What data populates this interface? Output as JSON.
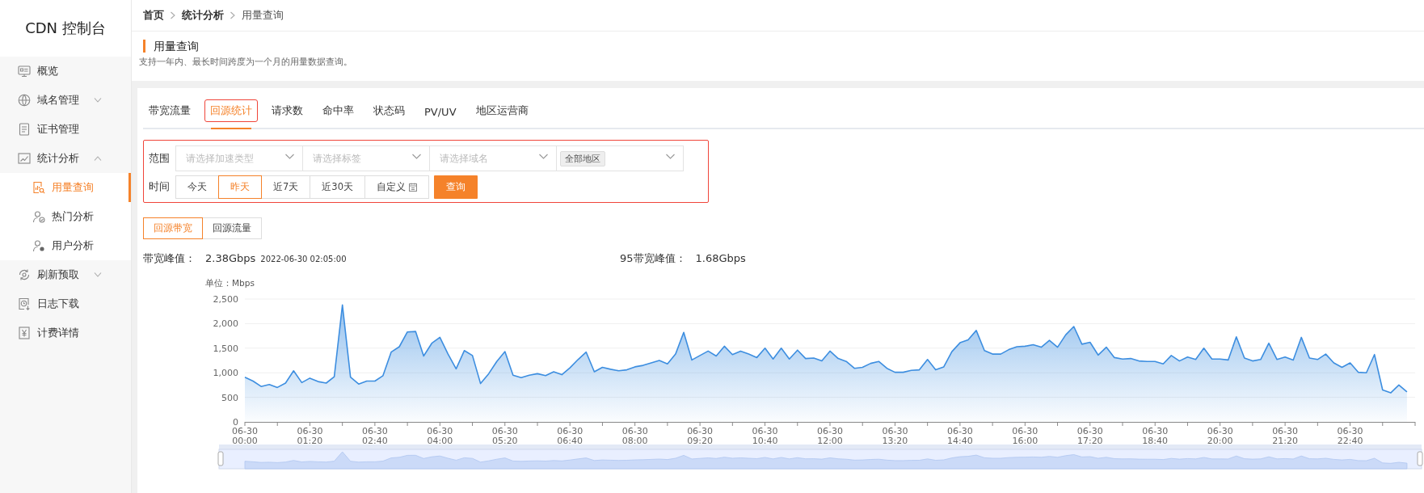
{
  "sidebar": {
    "title": "CDN 控制台",
    "items": [
      {
        "kind": "link",
        "label": "概览"
      },
      {
        "kind": "group",
        "label": "域名管理",
        "expanded": false
      },
      {
        "kind": "link",
        "label": "证书管理"
      },
      {
        "kind": "group",
        "label": "统计分析",
        "expanded": true,
        "children": [
          {
            "label": "用量查询",
            "selected": true
          },
          {
            "label": "热门分析",
            "selected": false
          },
          {
            "label": "用户分析",
            "selected": false
          }
        ]
      },
      {
        "kind": "group",
        "label": "刷新预取",
        "expanded": false
      },
      {
        "kind": "link",
        "label": "日志下载"
      },
      {
        "kind": "link",
        "label": "计费详情"
      }
    ]
  },
  "breadcrumb": [
    "首页",
    "统计分析",
    "用量查询"
  ],
  "page_header": {
    "title": "用量查询",
    "description": "支持一年内、最长时间跨度为一个月的用量数据查询。"
  },
  "tabs": [
    {
      "label": "带宽流量",
      "selected": false
    },
    {
      "label": "回源统计",
      "selected": true
    },
    {
      "label": "请求数",
      "selected": false
    },
    {
      "label": "命中率",
      "selected": false
    },
    {
      "label": "状态码",
      "selected": false
    },
    {
      "label": "PV/UV",
      "selected": false
    },
    {
      "label": "地区运营商",
      "selected": false
    }
  ],
  "filters": {
    "scope_label": "范围",
    "selects": [
      {
        "placeholder": "请选择加速类型"
      },
      {
        "placeholder": "请选择标签"
      },
      {
        "placeholder": "请选择域名"
      },
      {
        "tag": "全部地区"
      }
    ],
    "time_label": "时间",
    "time_options": [
      {
        "label": "今天",
        "selected": false
      },
      {
        "label": "昨天",
        "selected": true
      },
      {
        "label": "近7天",
        "selected": false
      },
      {
        "label": "近30天",
        "selected": false
      },
      {
        "label": "自定义",
        "selected": false,
        "calendar": true
      }
    ],
    "query_button": "查询"
  },
  "metric_toggle": [
    {
      "label": "回源带宽",
      "selected": true
    },
    {
      "label": "回源流量",
      "selected": false
    }
  ],
  "stats": {
    "peak_label": "带宽峰值：",
    "peak_value": "2.38Gbps",
    "peak_time": "2022-06-30 02:05:00",
    "p95_label": "95带宽峰值：",
    "p95_value": "1.68Gbps"
  },
  "chart_data": {
    "type": "area",
    "ylabel": "单位：Mbps",
    "grid": true,
    "ylim": [
      0,
      2500
    ],
    "yticks": [
      0,
      500,
      {
        "value": 1000,
        "label": "1,000"
      },
      {
        "value": 1500,
        "label": "1,500"
      },
      {
        "value": 2000,
        "label": "2,000"
      },
      {
        "value": 2500,
        "label": "2,500"
      }
    ],
    "categories": [
      "06-30 00:00",
      null,
      null,
      null,
      null,
      null,
      null,
      null,
      "06-30 01:20",
      null,
      null,
      null,
      null,
      null,
      null,
      null,
      "06-30 02:40",
      null,
      null,
      null,
      null,
      null,
      null,
      null,
      "06-30 04:00",
      null,
      null,
      null,
      null,
      null,
      null,
      null,
      "06-30 05:20",
      null,
      null,
      null,
      null,
      null,
      null,
      null,
      "06-30 06:40",
      null,
      null,
      null,
      null,
      null,
      null,
      null,
      "06-30 08:00",
      null,
      null,
      null,
      null,
      null,
      null,
      null,
      "06-30 09:20",
      null,
      null,
      null,
      null,
      null,
      null,
      null,
      "06-30 10:40",
      null,
      null,
      null,
      null,
      null,
      null,
      null,
      "06-30 12:00",
      null,
      null,
      null,
      null,
      null,
      null,
      null,
      "06-30 13:20",
      null,
      null,
      null,
      null,
      null,
      null,
      null,
      "06-30 14:40",
      null,
      null,
      null,
      null,
      null,
      null,
      null,
      "06-30 16:00",
      null,
      null,
      null,
      null,
      null,
      null,
      null,
      "06-30 17:20",
      null,
      null,
      null,
      null,
      null,
      null,
      null,
      "06-30 18:40",
      null,
      null,
      null,
      null,
      null,
      null,
      null,
      "06-30 20:00",
      null,
      null,
      null,
      null,
      null,
      null,
      null,
      "06-30 21:20",
      null,
      null,
      null,
      null,
      null,
      null,
      null,
      "06-30 22:40",
      null,
      null,
      null,
      null,
      null,
      null,
      null
    ],
    "series": [
      {
        "color": "#3d8ee0",
        "values": [
          910,
          830,
          720,
          760,
          700,
          790,
          1040,
          800,
          890,
          820,
          790,
          920,
          2380,
          910,
          770,
          830,
          830,
          940,
          1420,
          1530,
          1830,
          1840,
          1340,
          1600,
          1720,
          1380,
          1080,
          1450,
          1350,
          780,
          980,
          1230,
          1430,
          950,
          900,
          950,
          980,
          940,
          1020,
          960,
          1100,
          1270,
          1420,
          1020,
          1110,
          1070,
          1040,
          1060,
          1120,
          1150,
          1200,
          1250,
          1180,
          1380,
          1820,
          1260,
          1350,
          1440,
          1340,
          1540,
          1370,
          1440,
          1380,
          1310,
          1500,
          1280,
          1500,
          1280,
          1460,
          1290,
          1300,
          1240,
          1440,
          1290,
          1230,
          1090,
          1110,
          1190,
          1230,
          1090,
          1010,
          1010,
          1050,
          1060,
          1270,
          1060,
          1120,
          1430,
          1610,
          1670,
          1860,
          1450,
          1380,
          1380,
          1470,
          1530,
          1540,
          1570,
          1520,
          1660,
          1520,
          1770,
          1940,
          1580,
          1620,
          1360,
          1520,
          1310,
          1280,
          1290,
          1240,
          1230,
          1230,
          1180,
          1350,
          1240,
          1320,
          1270,
          1500,
          1280,
          1280,
          1260,
          1730,
          1300,
          1240,
          1270,
          1600,
          1270,
          1320,
          1260,
          1720,
          1300,
          1270,
          1380,
          1200,
          1110,
          1200,
          1010,
          1000,
          1370,
          650,
          590,
          750,
          610
        ]
      }
    ]
  }
}
